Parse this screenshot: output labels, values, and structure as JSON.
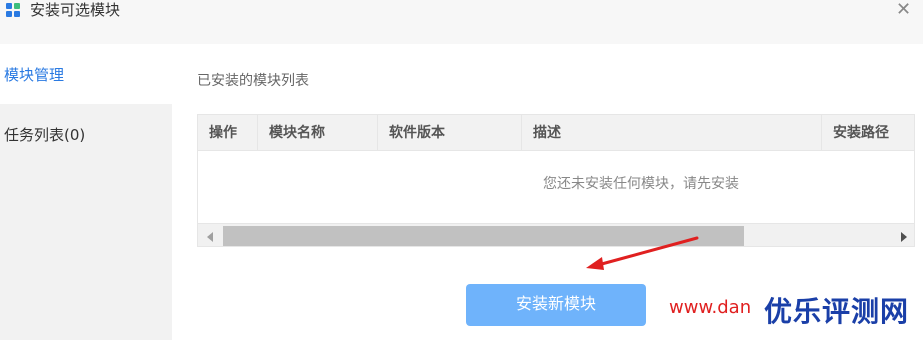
{
  "window": {
    "title": "安装可选模块",
    "icon": "modules-grid-icon",
    "close_icon": "close-icon"
  },
  "sidebar": {
    "items": [
      {
        "label": "模块管理",
        "active": true
      },
      {
        "label": "任务列表(0)",
        "active": false
      }
    ]
  },
  "main": {
    "section_label": "已安装的模块列表",
    "table": {
      "columns": [
        "操作",
        "模块名称",
        "软件版本",
        "描述",
        "安装路径"
      ],
      "rows": [],
      "empty_text": "您还未安装任何模块，请先安装"
    },
    "install_button": "安装新模块"
  },
  "watermark": {
    "url": "www.dan",
    "brand": "优乐评测网"
  },
  "colors": {
    "accent": "#2a7ae2",
    "button": "#6fb3fb",
    "arrow": "#e02020",
    "brand": "#1a3fa8"
  }
}
